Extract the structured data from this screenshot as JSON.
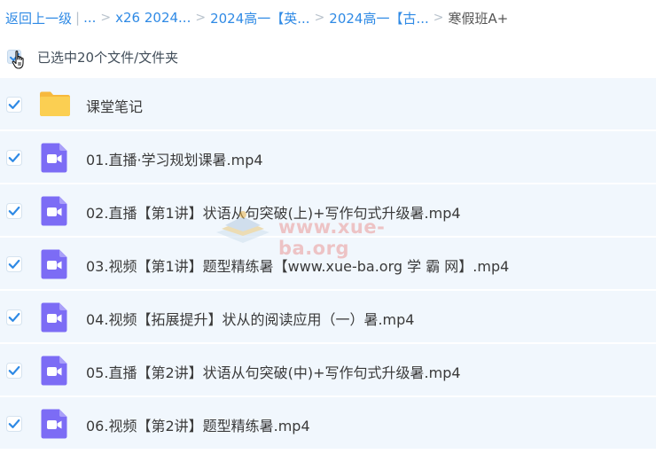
{
  "breadcrumb": {
    "back": "返回上一级",
    "ellipsis": "...",
    "items": [
      "x26 2024...",
      "2024高一【英...",
      "2024高一【古..."
    ],
    "current": "寒假班A+"
  },
  "selection": {
    "summary": "已选中20个文件/文件夹"
  },
  "files": [
    {
      "name": "课堂笔记",
      "type": "folder",
      "checked": true
    },
    {
      "name": "01.直播·学习规划课暑.mp4",
      "type": "video",
      "checked": true
    },
    {
      "name": "02.直播【第1讲】状语从句突破(上)+写作句式升级暑.mp4",
      "type": "video",
      "checked": true
    },
    {
      "name": "03.视频【第1讲】题型精练暑【www.xue-ba.org 学 霸 网】.mp4",
      "type": "video",
      "checked": true
    },
    {
      "name": "04.视频【拓展提升】状从的阅读应用（一）暑.mp4",
      "type": "video",
      "checked": true
    },
    {
      "name": "05.直播【第2讲】状语从句突破(中)+写作句式升级暑.mp4",
      "type": "video",
      "checked": true
    },
    {
      "name": "06.视频【第2讲】题型精练暑.mp4",
      "type": "video",
      "checked": true
    }
  ],
  "watermark": {
    "text": "www.xue-ba.org"
  },
  "colors": {
    "link": "#2f8ae5",
    "checkbox": "#2f8ae5",
    "row_bg": "#f1f7fd",
    "folder": "#f9c84a",
    "video": "#7b6cf6"
  }
}
